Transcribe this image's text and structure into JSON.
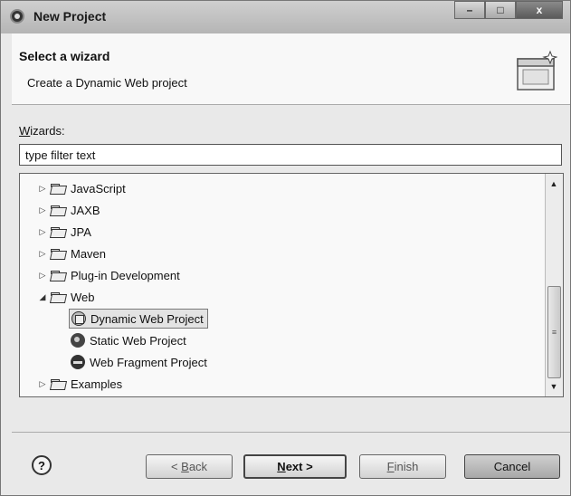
{
  "window": {
    "title": "New Project",
    "controls": {
      "minimize": "–",
      "maximize": "□",
      "close": "x"
    }
  },
  "header": {
    "title": "Select a wizard",
    "description": "Create a Dynamic Web project"
  },
  "wizards": {
    "label_mnemonic": "W",
    "label_rest": "izards:",
    "filter_value": "type filter text"
  },
  "tree": {
    "items": [
      {
        "label": "JavaScript",
        "state": "collapsed",
        "level": 0,
        "icon": "folder-icon"
      },
      {
        "label": "JAXB",
        "state": "collapsed",
        "level": 0,
        "icon": "folder-icon"
      },
      {
        "label": "JPA",
        "state": "collapsed",
        "level": 0,
        "icon": "folder-icon"
      },
      {
        "label": "Maven",
        "state": "collapsed",
        "level": 0,
        "icon": "folder-icon"
      },
      {
        "label": "Plug-in Development",
        "state": "collapsed",
        "level": 0,
        "icon": "folder-icon"
      },
      {
        "label": "Web",
        "state": "expanded",
        "level": 0,
        "icon": "folder-icon"
      },
      {
        "label": "Dynamic Web Project",
        "state": "leaf",
        "level": 1,
        "icon": "dynamic-web-project-icon",
        "selected": true
      },
      {
        "label": "Static Web Project",
        "state": "leaf",
        "level": 1,
        "icon": "static-web-project-icon"
      },
      {
        "label": "Web Fragment Project",
        "state": "leaf",
        "level": 1,
        "icon": "web-fragment-project-icon"
      },
      {
        "label": "Examples",
        "state": "collapsed",
        "level": 0,
        "icon": "folder-icon"
      }
    ]
  },
  "footer": {
    "help_symbol": "?",
    "back": {
      "prefix": "< ",
      "mnemonic": "B",
      "rest": "ack",
      "enabled": false
    },
    "next": {
      "mnemonic": "N",
      "rest": "ext >",
      "default": true
    },
    "finish": {
      "mnemonic": "F",
      "rest": "inish",
      "enabled": false
    },
    "cancel": {
      "label": "Cancel"
    }
  }
}
